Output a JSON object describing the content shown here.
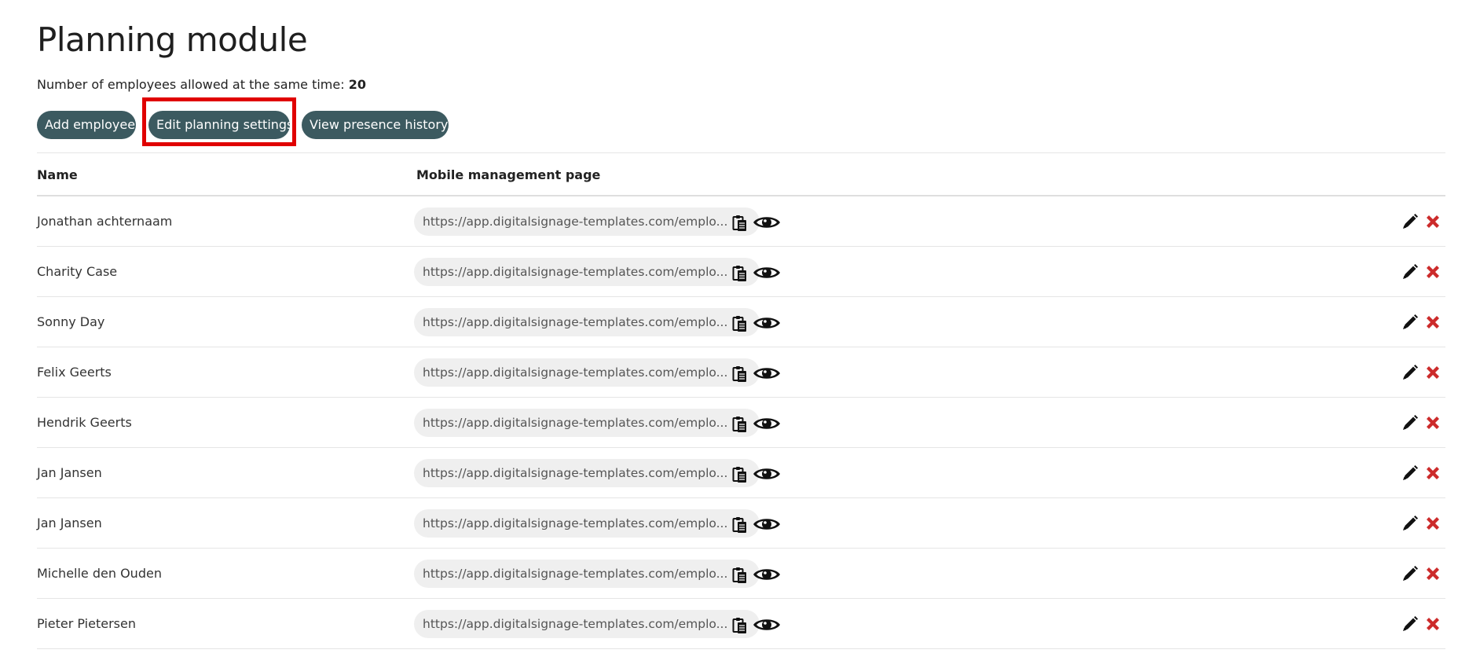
{
  "page": {
    "title": "Planning module",
    "allowed_label": "Number of employees allowed at the same time:",
    "allowed_value": "20"
  },
  "toolbar": {
    "add_label": "Add employee",
    "edit_label": "Edit planning settings",
    "history_label": "View presence history"
  },
  "table": {
    "columns": [
      "Name",
      "Mobile management page"
    ],
    "rows": [
      {
        "name": "Jonathan achternaam",
        "url": "https://app.digitalsignage-templates.com/emplo..."
      },
      {
        "name": "Charity Case",
        "url": "https://app.digitalsignage-templates.com/emplo..."
      },
      {
        "name": "Sonny  Day",
        "url": "https://app.digitalsignage-templates.com/emplo..."
      },
      {
        "name": "Felix Geerts",
        "url": "https://app.digitalsignage-templates.com/emplo..."
      },
      {
        "name": "Hendrik Geerts",
        "url": "https://app.digitalsignage-templates.com/emplo..."
      },
      {
        "name": "Jan Jansen",
        "url": "https://app.digitalsignage-templates.com/emplo..."
      },
      {
        "name": "Jan Jansen",
        "url": "https://app.digitalsignage-templates.com/emplo..."
      },
      {
        "name": "Michelle den Ouden",
        "url": "https://app.digitalsignage-templates.com/emplo..."
      },
      {
        "name": "Pieter  Pietersen",
        "url": "https://app.digitalsignage-templates.com/emplo..."
      }
    ]
  },
  "icons": {
    "copy": "clipboard-icon",
    "view": "eye-icon",
    "edit": "pencil-icon",
    "delete": "close-icon"
  },
  "colors": {
    "button_bg": "#3c5a60",
    "button_text": "#ffffff",
    "highlight": "#e00000",
    "delete": "#cc2b2b",
    "url_pill_bg": "#efefef"
  }
}
